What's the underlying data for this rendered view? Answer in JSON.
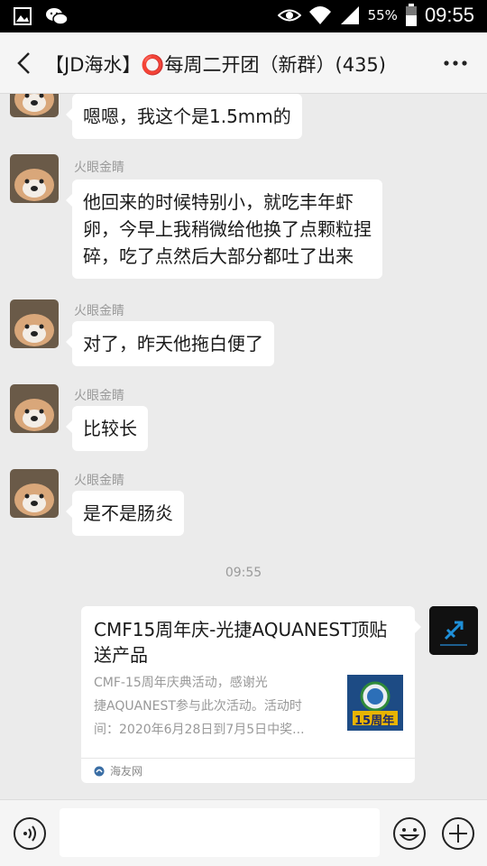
{
  "status_bar": {
    "battery": "55%",
    "time": "09:55",
    "icons": [
      "gallery-icon",
      "wechat-icon",
      "eye-icon",
      "wifi-icon",
      "signal-icon",
      "battery-icon"
    ]
  },
  "header": {
    "title": "【JD海水】⭕每周二开团（新群）(435)",
    "back_icon": "chevron-left-icon",
    "more_icon": "more-dots-icon"
  },
  "messages": [
    {
      "sender": "",
      "text": "嗯嗯，我这个是1.5mm的"
    },
    {
      "sender": "火眼金睛",
      "lines": [
        "他回来的时候特别小，就吃丰年虾",
        "卵，今早上我稍微给他换了点颗粒捏",
        "碎，吃了点然后大部分都吐了出来"
      ]
    },
    {
      "sender": "火眼金睛",
      "text": "对了，昨天他拖白便了"
    },
    {
      "sender": "火眼金睛",
      "text": "比较长"
    },
    {
      "sender": "火眼金睛",
      "text": "是不是肠炎"
    }
  ],
  "timestamp": "09:55",
  "link_card": {
    "title": "CMF15周年庆-光捷AQUANEST顶贴送产品",
    "desc_lines": [
      "CMF-15周年庆典活动，感谢光",
      "捷AQUANEST参与此次活动。活动时",
      "间：2020年6月28日到7月5日中奖..."
    ],
    "thumb_text": "15周年",
    "source": "海友网"
  },
  "input_bar": {
    "placeholder": "",
    "icons": [
      "voice-icon",
      "emoji-icon",
      "plus-icon"
    ]
  },
  "colors": {
    "background": "#ebebeb",
    "bubble": "#ffffff",
    "status_bar": "#000000",
    "title_bar": "#f5f5f5"
  }
}
